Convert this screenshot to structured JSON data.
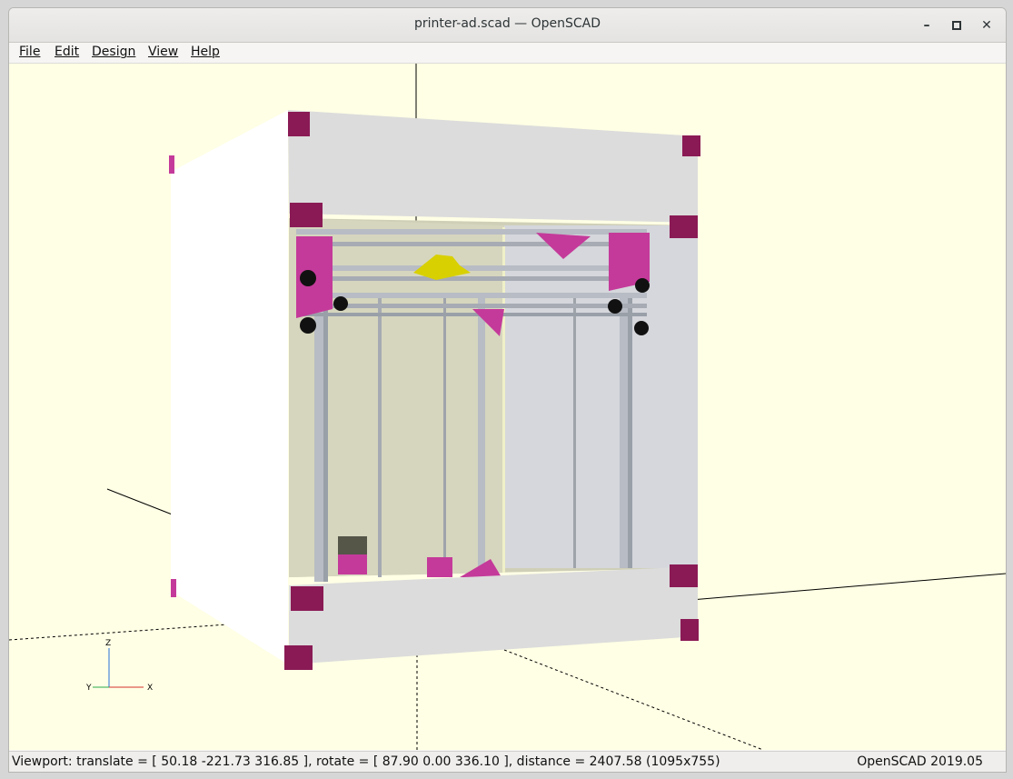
{
  "window": {
    "title": "printer-ad.scad — OpenSCAD",
    "minimize_glyph": "–",
    "maximize_glyph": "□",
    "close_glyph": "✕"
  },
  "menubar": {
    "items": [
      "File",
      "Edit",
      "Design",
      "View",
      "Help"
    ]
  },
  "viewport": {
    "background_color": "#ffffe5",
    "axes_labels": {
      "z": "Z",
      "y": "Y",
      "x": "X"
    },
    "colors": {
      "frame_panel": "#dcdcdc",
      "corner_block": "#8a1a55",
      "printed_part": "#c43a9a",
      "extrusion": "#b8bcc4",
      "filament": "#d8d000"
    }
  },
  "statusbar": {
    "viewport_info": "Viewport: translate = [ 50.18 -221.73 316.85 ], rotate = [ 87.90 0.00 336.10 ], distance = 2407.58 (1095x755)",
    "version": "OpenSCAD 2019.05"
  }
}
